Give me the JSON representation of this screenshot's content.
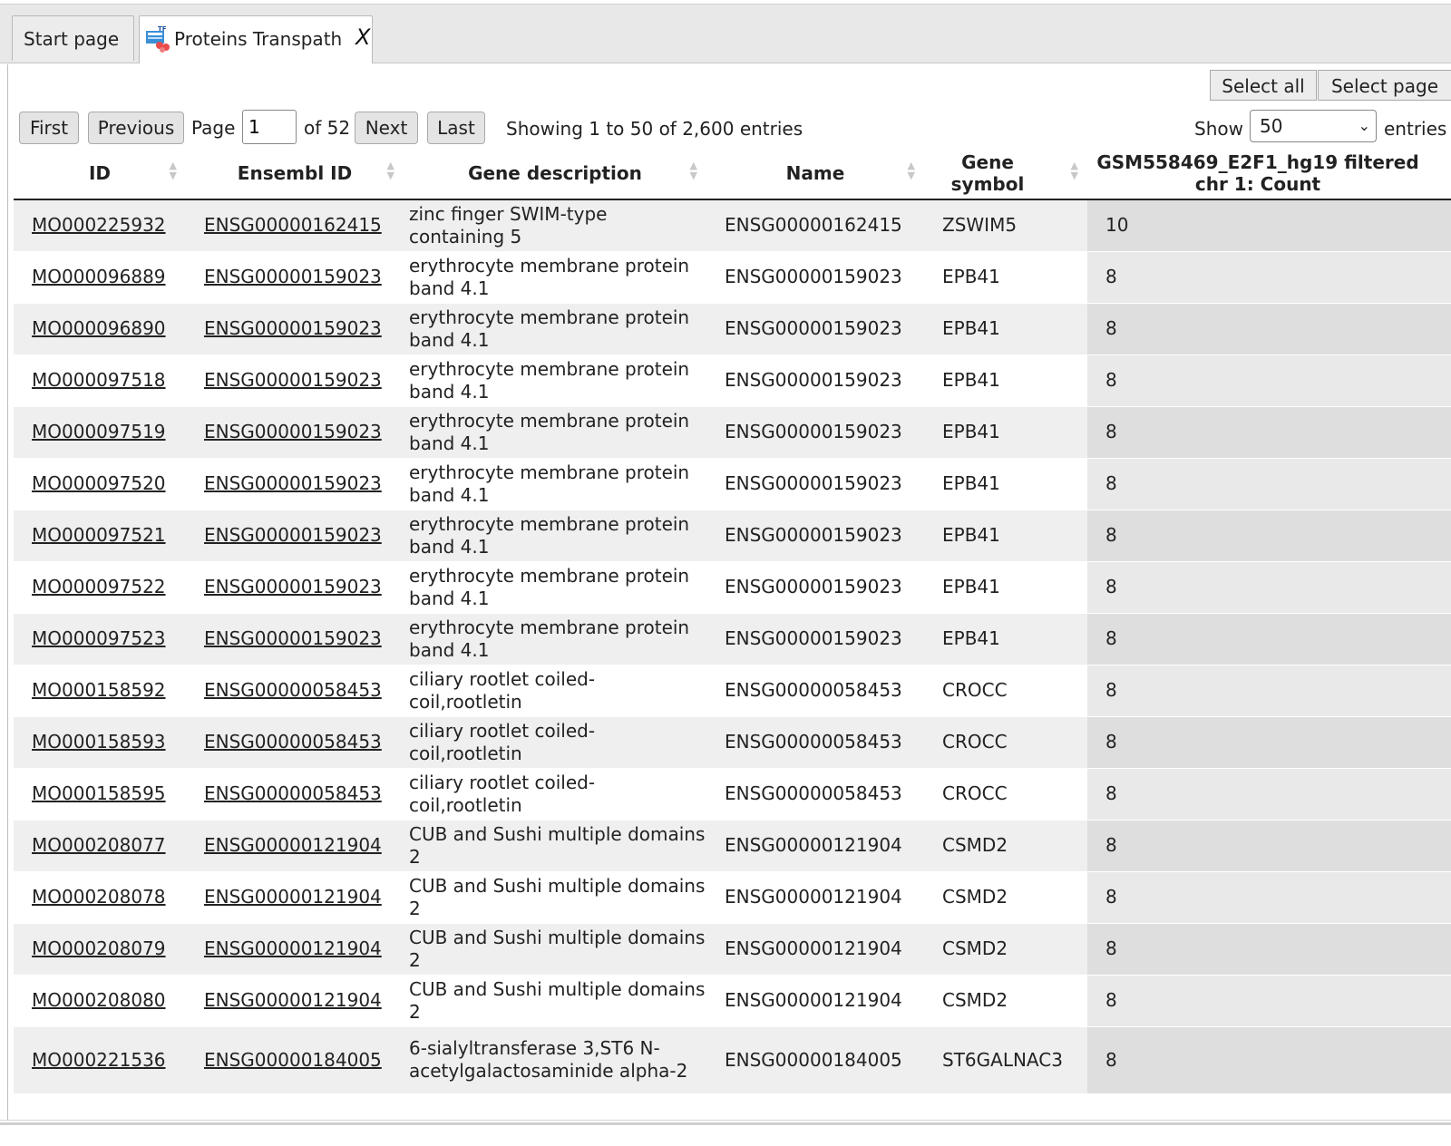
{
  "tabs": {
    "start_label": "Start page",
    "proteins_label": "Proteins Transpath",
    "close_label": "X"
  },
  "toolbar": {
    "select_all": "Select all",
    "select_page": "Select page",
    "first": "First",
    "previous": "Previous",
    "page_label": "Page",
    "page_value": "1",
    "of_label": "of 52",
    "next": "Next",
    "last": "Last",
    "showing": "Showing 1 to 50 of 2,600 entries",
    "show_label": "Show",
    "show_value": "50",
    "entries_label": "entries"
  },
  "table": {
    "headers": {
      "id": "ID",
      "ensembl": "Ensembl ID",
      "description": "Gene description",
      "name": "Name",
      "symbol": "Gene symbol",
      "count": "GSM558469_E2F1_hg19 filtered chr 1: Count"
    },
    "rows": [
      {
        "id": "MO000225932",
        "ensembl": "ENSG00000162415",
        "description": "zinc finger SWIM-type containing 5",
        "name": "ENSG00000162415",
        "symbol": "ZSWIM5",
        "count": "10"
      },
      {
        "id": "MO000096889",
        "ensembl": "ENSG00000159023",
        "description": "erythrocyte membrane protein band 4.1",
        "name": "ENSG00000159023",
        "symbol": "EPB41",
        "count": "8"
      },
      {
        "id": "MO000096890",
        "ensembl": "ENSG00000159023",
        "description": "erythrocyte membrane protein band 4.1",
        "name": "ENSG00000159023",
        "symbol": "EPB41",
        "count": "8"
      },
      {
        "id": "MO000097518",
        "ensembl": "ENSG00000159023",
        "description": "erythrocyte membrane protein band 4.1",
        "name": "ENSG00000159023",
        "symbol": "EPB41",
        "count": "8"
      },
      {
        "id": "MO000097519",
        "ensembl": "ENSG00000159023",
        "description": "erythrocyte membrane protein band 4.1",
        "name": "ENSG00000159023",
        "symbol": "EPB41",
        "count": "8"
      },
      {
        "id": "MO000097520",
        "ensembl": "ENSG00000159023",
        "description": "erythrocyte membrane protein band 4.1",
        "name": "ENSG00000159023",
        "symbol": "EPB41",
        "count": "8"
      },
      {
        "id": "MO000097521",
        "ensembl": "ENSG00000159023",
        "description": "erythrocyte membrane protein band 4.1",
        "name": "ENSG00000159023",
        "symbol": "EPB41",
        "count": "8"
      },
      {
        "id": "MO000097522",
        "ensembl": "ENSG00000159023",
        "description": "erythrocyte membrane protein band 4.1",
        "name": "ENSG00000159023",
        "symbol": "EPB41",
        "count": "8"
      },
      {
        "id": "MO000097523",
        "ensembl": "ENSG00000159023",
        "description": "erythrocyte membrane protein band 4.1",
        "name": "ENSG00000159023",
        "symbol": "EPB41",
        "count": "8"
      },
      {
        "id": "MO000158592",
        "ensembl": "ENSG00000058453",
        "description": "ciliary rootlet coiled-coil,rootletin",
        "name": "ENSG00000058453",
        "symbol": "CROCC",
        "count": "8"
      },
      {
        "id": "MO000158593",
        "ensembl": "ENSG00000058453",
        "description": "ciliary rootlet coiled-coil,rootletin",
        "name": "ENSG00000058453",
        "symbol": "CROCC",
        "count": "8"
      },
      {
        "id": "MO000158595",
        "ensembl": "ENSG00000058453",
        "description": "ciliary rootlet coiled-coil,rootletin",
        "name": "ENSG00000058453",
        "symbol": "CROCC",
        "count": "8"
      },
      {
        "id": "MO000208077",
        "ensembl": "ENSG00000121904",
        "description": "CUB and Sushi multiple domains 2",
        "name": "ENSG00000121904",
        "symbol": "CSMD2",
        "count": "8"
      },
      {
        "id": "MO000208078",
        "ensembl": "ENSG00000121904",
        "description": "CUB and Sushi multiple domains 2",
        "name": "ENSG00000121904",
        "symbol": "CSMD2",
        "count": "8"
      },
      {
        "id": "MO000208079",
        "ensembl": "ENSG00000121904",
        "description": "CUB and Sushi multiple domains 2",
        "name": "ENSG00000121904",
        "symbol": "CSMD2",
        "count": "8"
      },
      {
        "id": "MO000208080",
        "ensembl": "ENSG00000121904",
        "description": "CUB and Sushi multiple domains 2",
        "name": "ENSG00000121904",
        "symbol": "CSMD2",
        "count": "8"
      },
      {
        "id": "MO000221536",
        "ensembl": "ENSG00000184005",
        "description": "6-sialyltransferase 3,ST6 N-acetylgalactosaminide alpha-2",
        "name": "ENSG00000184005",
        "symbol": "ST6GALNAC3",
        "count": "8"
      }
    ]
  },
  "icons": {
    "tab_icon": "table-network-icon",
    "sort": "sort-arrows-icon",
    "sort_desc": "sort-descending-icon",
    "chevron": "chevron-down-icon"
  },
  "colors": {
    "sort_active": "#6b6bd8",
    "row_odd": "#efefef",
    "count_column": "#dedede"
  }
}
